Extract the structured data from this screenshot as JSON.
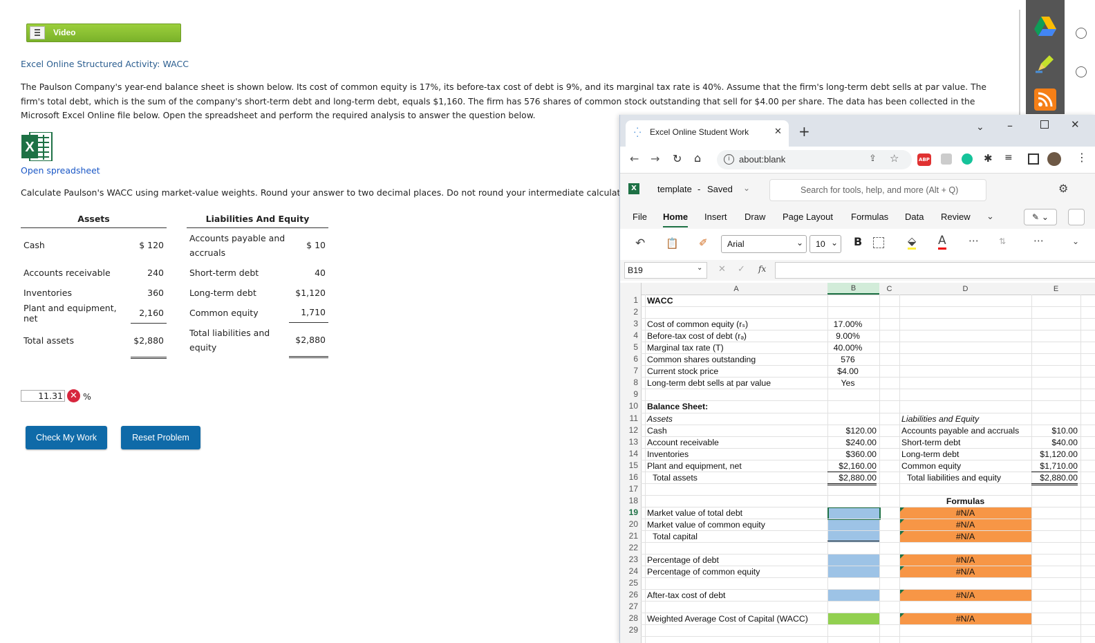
{
  "video": {
    "label": "Video"
  },
  "activity": {
    "title": "Excel Online Structured Activity: WACC"
  },
  "problem": {
    "text": "The Paulson Company's year-end balance sheet is shown below. Its cost of common equity is 17%, its before-tax cost of debt is 9%, and its marginal tax rate is 40%. Assume that the firm's long-term debt sells at par value. The firm's total debt, which is the sum of the company's short-term debt and long-term debt, equals $1,160. The firm has 576 shares of common stock outstanding that sell for $4.00 per share. The data has been collected in the Microsoft Excel Online file below. Open the spreadsheet and perform the required analysis to answer the question below."
  },
  "open_spreadsheet": "Open spreadsheet",
  "question": "Calculate Paulson's WACC using market-value weights. Round your answer to two decimal places. Do not round your intermediate calculations.",
  "balance": {
    "assets_header": "Assets",
    "liab_header": "Liabilities And Equity",
    "assets": [
      {
        "label": "Cash",
        "value": "$ 120"
      },
      {
        "label": "Accounts receivable",
        "value": "240"
      },
      {
        "label": "Inventories",
        "value": "360"
      },
      {
        "label": "Plant and equipment, net",
        "value": "2,160"
      },
      {
        "label": "Total assets",
        "value": "$2,880"
      }
    ],
    "liabilities": [
      {
        "label": "Accounts payable and accruals",
        "value": "$ 10"
      },
      {
        "label": "Short-term debt",
        "value": "40"
      },
      {
        "label": "Long-term debt",
        "value": "$1,120"
      },
      {
        "label": "Common equity",
        "value": "1,710"
      },
      {
        "label": "Total liabilities and equity",
        "value": "$2,880"
      }
    ]
  },
  "answer": {
    "value": "11.31",
    "unit": "%"
  },
  "buttons": {
    "check": "Check My Work",
    "reset": "Reset Problem"
  },
  "browser": {
    "tab_title": "Excel Online Student Work",
    "url": "about:blank",
    "ext_abp": "ABP"
  },
  "excel": {
    "file_name": "template",
    "saved_status": "Saved",
    "search_placeholder": "Search for tools, help, and more (Alt + Q)",
    "menu": [
      "File",
      "Home",
      "Insert",
      "Draw",
      "Page Layout",
      "Formulas",
      "Data",
      "Review"
    ],
    "font": "Arial",
    "font_size": "10",
    "name_box": "B19",
    "fx": "fx",
    "columns": [
      "A",
      "B",
      "C",
      "D",
      "E"
    ],
    "cells": {
      "A1": "WACC",
      "A3": "Cost of common equity (rₛ)",
      "B3": "17.00%",
      "A4": "Before-tax cost of debt (rₔ)",
      "B4": "9.00%",
      "A5": "Marginal tax rate (T)",
      "B5": "40.00%",
      "A6": "Common shares outstanding",
      "B6": "576",
      "A7": "Current stock price",
      "B7": "$4.00",
      "A8": "Long-term debt sells at par value",
      "B8": "Yes",
      "A10": "Balance Sheet:",
      "A11": "Assets",
      "D11": "Liabilities and Equity",
      "A12": "Cash",
      "B12": "$120.00",
      "D12": "Accounts payable and accruals",
      "E12": "$10.00",
      "A13": "Account receivable",
      "B13": "$240.00",
      "D13": "Short-term debt",
      "E13": "$40.00",
      "A14": "Inventories",
      "B14": "$360.00",
      "D14": "Long-term debt",
      "E14": "$1,120.00",
      "A15": "Plant and equipment, net",
      "B15": "$2,160.00",
      "D15": "Common equity",
      "E15": "$1,710.00",
      "A16": "Total assets",
      "B16": "$2,880.00",
      "D16": "Total liabilities and equity",
      "E16": "$2,880.00",
      "D18": "Formulas",
      "A19": "Market value of total debt",
      "D19": "#N/A",
      "A20": "Market value of common equity",
      "D20": "#N/A",
      "A21": "Total capital",
      "D21": "#N/A",
      "A23": "Percentage of debt",
      "D23": "#N/A",
      "A24": "Percentage of common equity",
      "D24": "#N/A",
      "A26": "After-tax cost of debt",
      "D26": "#N/A",
      "A28": "Weighted Average Cost of Capital (WACC)",
      "D28": "#N/A"
    },
    "colors": {
      "input_blue": "#9dc3e6",
      "formula_orange": "#f79646",
      "wacc_green": "#92d050"
    }
  }
}
